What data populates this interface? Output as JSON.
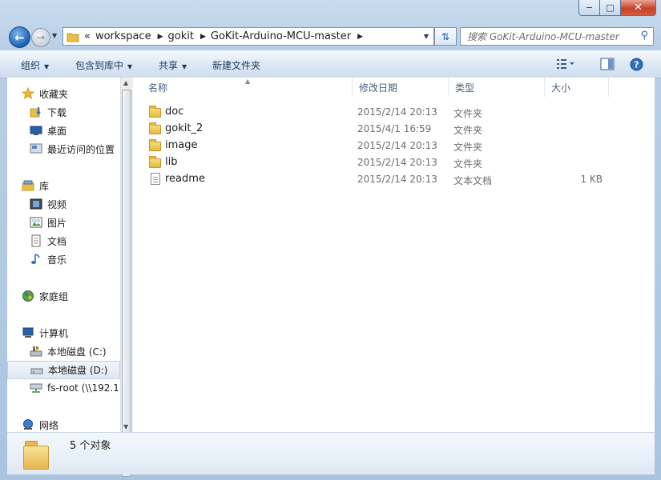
{
  "window": {
    "caption": {
      "minimize": "−",
      "maximize": "□",
      "close": "✕"
    }
  },
  "address": {
    "overflow": "«",
    "segments": [
      "workspace",
      "gokit",
      "GoKit-Arduino-MCU-master"
    ],
    "search_placeholder": "搜索 GoKit-Arduino-MCU-master"
  },
  "toolbar": {
    "organize": "组织",
    "include_library": "包含到库中",
    "share": "共享",
    "new_folder": "新建文件夹"
  },
  "sidebar": {
    "favorites": "收藏夹",
    "downloads": "下载",
    "desktop": "桌面",
    "recent": "最近访问的位置",
    "libraries": "库",
    "videos": "视频",
    "pictures": "图片",
    "documents": "文档",
    "music": "音乐",
    "homegroup": "家庭组",
    "computer": "计算机",
    "drive_c": "本地磁盘 (C:)",
    "drive_d": "本地磁盘 (D:)",
    "fs_root": "fs-root (\\\\192.1",
    "network": "网络"
  },
  "columns": {
    "name": "名称",
    "modified": "修改日期",
    "type": "类型",
    "size": "大小"
  },
  "files": [
    {
      "name": "doc",
      "modified": "2015/2/14 20:13",
      "type": "文件夹",
      "size": ""
    },
    {
      "name": "gokit_2",
      "modified": "2015/4/1 16:59",
      "type": "文件夹",
      "size": ""
    },
    {
      "name": "image",
      "modified": "2015/2/14 20:13",
      "type": "文件夹",
      "size": ""
    },
    {
      "name": "lib",
      "modified": "2015/2/14 20:13",
      "type": "文件夹",
      "size": ""
    },
    {
      "name": "readme",
      "modified": "2015/2/14 20:13",
      "type": "文本文档",
      "size": "1 KB"
    }
  ],
  "status": {
    "count_text": "5 个对象"
  },
  "colors": {
    "selection": "#dfe8f3",
    "title_bg": "#c9dcef",
    "close_red": "#c8412b"
  }
}
